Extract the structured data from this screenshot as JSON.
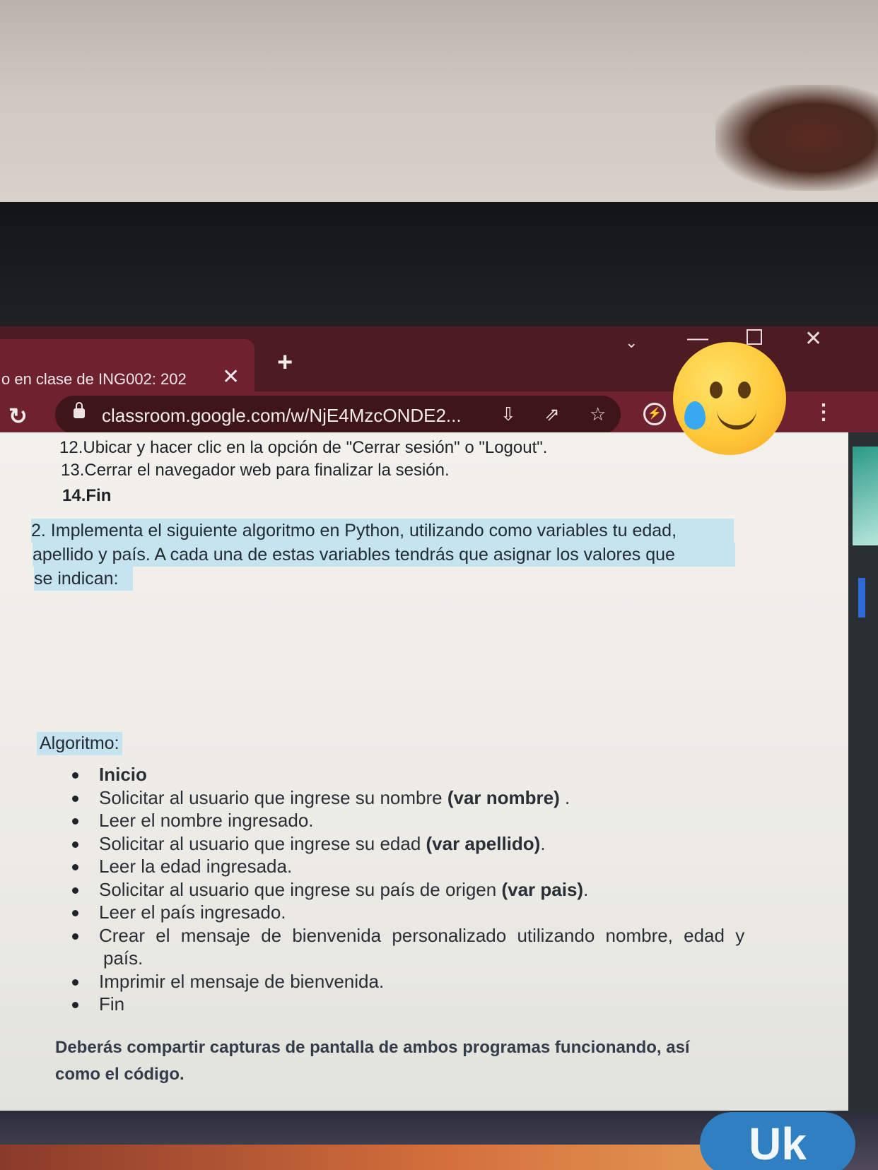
{
  "browser": {
    "tab_title": "o en clase de ING002: 202",
    "tab_close": "✕",
    "new_tab": "+",
    "url": "classroom.google.com/w/NjE4MzcONDE2...",
    "window_controls": {
      "menu": "⌄",
      "minimize": "—",
      "close": "✕"
    }
  },
  "document": {
    "steps": [
      {
        "number": "12.",
        "text": "Ubicar y hacer clic en la opción de \"Cerrar sesión\" o \"Logout\"."
      },
      {
        "number": "13.",
        "text": "Cerrar el navegador web para finalizar la sesión."
      },
      {
        "number": "14.",
        "text": "Fin"
      }
    ],
    "instruction_lines": [
      "2. Implementa el siguiente algoritmo en Python, utilizando como variables tu edad,",
      "apellido y país. A cada una de estas variables tendrás que asignar los valores que",
      "se indican:"
    ],
    "algorithm_label": "Algoritmo:",
    "bullets": [
      {
        "text": "Inicio",
        "bold": ""
      },
      {
        "text": "Solicitar al usuario que ingrese su nombre ",
        "bold": "(var nombre)",
        "tail": " ."
      },
      {
        "text": "Leer el nombre ingresado.",
        "bold": ""
      },
      {
        "text": "Solicitar al usuario que ingrese su edad ",
        "bold": "(var apellido)",
        "tail": "."
      },
      {
        "text": "Leer la edad ingresada.",
        "bold": ""
      },
      {
        "text": "Solicitar al usuario que ingrese su país de origen ",
        "bold": "(var pais)",
        "tail": "."
      },
      {
        "text": "Leer el país ingresado.",
        "bold": ""
      },
      {
        "text": "Crear el mensaje de bienvenida personalizado utilizando nombre, edad y",
        "bold": ""
      },
      {
        "text": "país.",
        "bold": "",
        "continuation": true
      },
      {
        "text": "Imprimir el mensaje de bienvenida.",
        "bold": ""
      },
      {
        "text": "Fin",
        "bold": ""
      }
    ],
    "closing_lines": [
      "Deberás compartir capturas de pantalla de ambos programas funcionando, así",
      "como el código."
    ]
  },
  "taskbar": {
    "badge": "Uk"
  },
  "colors": {
    "chrome_titlebar": "#4c1c22",
    "chrome_toolbar": "#6e2230",
    "highlight": "#c5e4ef"
  },
  "icons": [
    "reload-icon",
    "lock-icon",
    "install-icon",
    "share-icon",
    "star-icon",
    "extension-icon",
    "kebab-menu-icon",
    "crying-emoji-sticker"
  ]
}
